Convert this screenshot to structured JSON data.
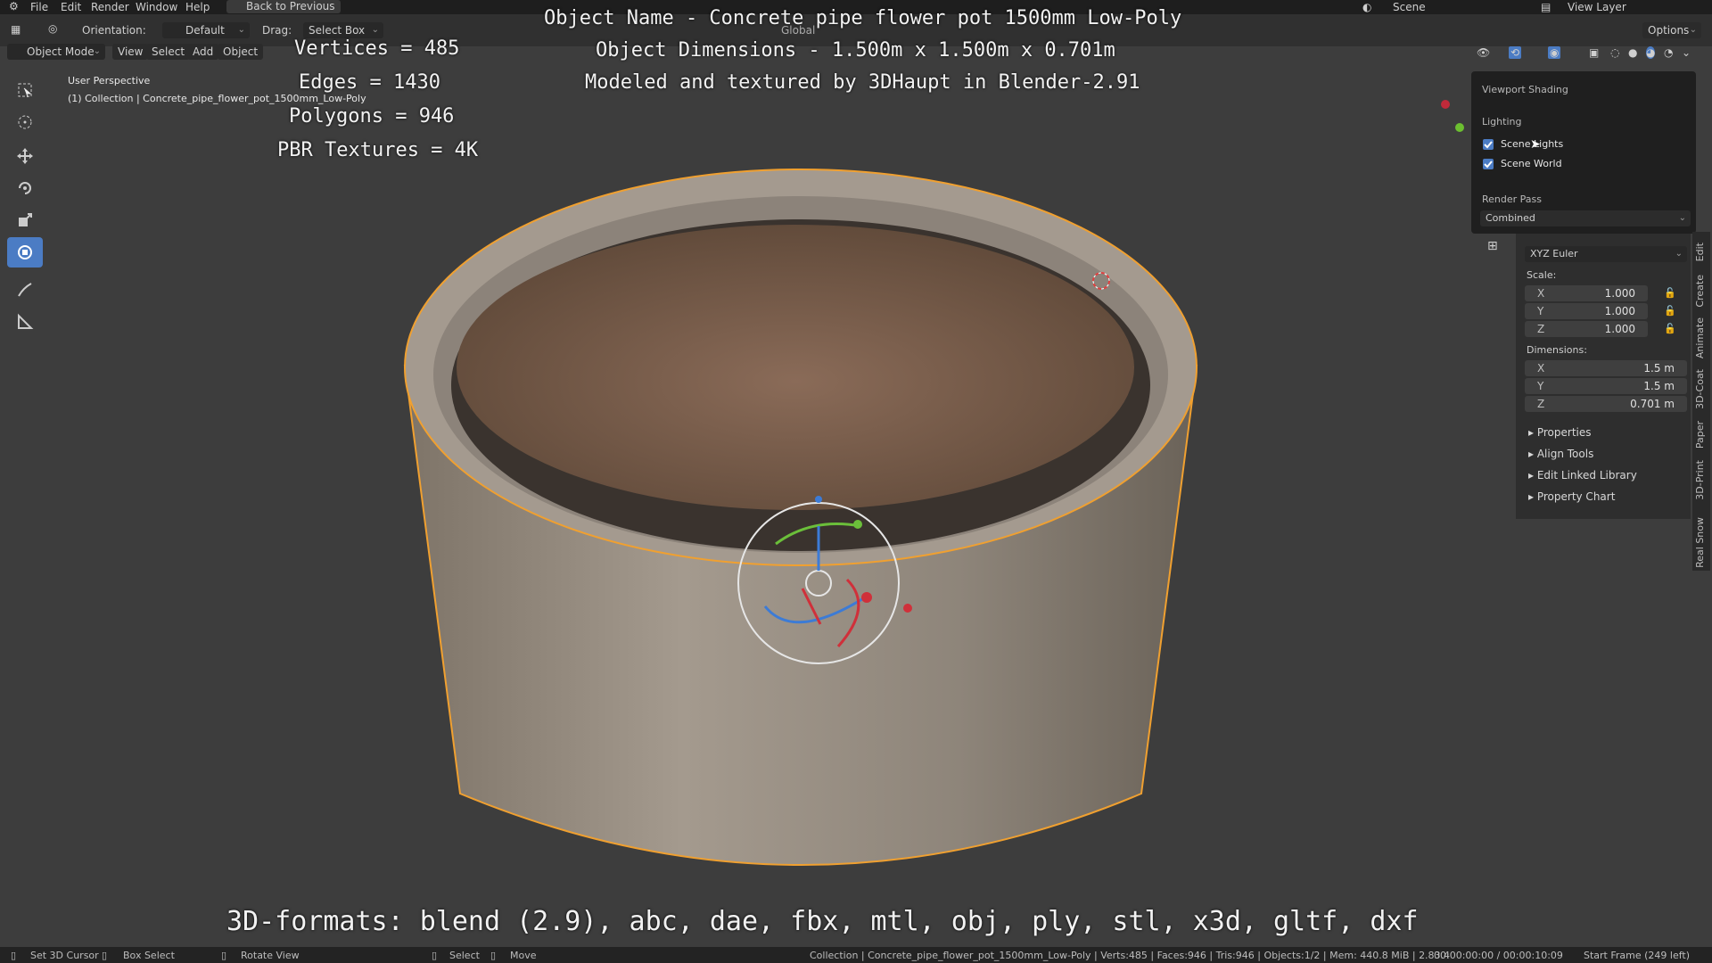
{
  "menu": {
    "items": [
      "File",
      "Edit",
      "Render",
      "Window",
      "Help"
    ],
    "back_button": "Back to Previous",
    "scene": "Scene",
    "view_layer": "View Layer"
  },
  "header": {
    "orientation_label": "Orientation:",
    "orientation_value": "Default",
    "drag_label": "Drag:",
    "drag_value": "Select Box",
    "transform_orientation": "Global",
    "options": "Options",
    "mode": "Object Mode",
    "menus": [
      "View",
      "Select",
      "Add",
      "Object"
    ]
  },
  "viewport": {
    "perspective": "User Perspective",
    "collection_info": "(1) Collection | Concrete_pipe_flower_pot_1500mm_Low-Poly",
    "stats": [
      "Vertices = 485",
      "Edges = 1430",
      "Polygons = 946",
      "PBR Textures = 4K"
    ],
    "title_lines": [
      "Object Name - Concrete pipe flower pot 1500mm Low-Poly",
      "Object Dimensions -  1.500m x 1.500m x 0.701m",
      "Modeled and textured by 3DHaupt in Blender-2.91"
    ],
    "formats": "3D-formats: blend (2.9), abc, dae, fbx, mtl, obj, ply, stl, x3d, gltf, dxf"
  },
  "shading_popover": {
    "title": "Viewport Shading",
    "lighting_label": "Lighting",
    "scene_lights": "Scene Lights",
    "scene_world": "Scene World",
    "render_pass_label": "Render Pass",
    "render_pass_value": "Combined"
  },
  "npanel": {
    "rotation_mode": "XYZ Euler",
    "scale_label": "Scale:",
    "scale": [
      {
        "axis": "X",
        "value": "1.000"
      },
      {
        "axis": "Y",
        "value": "1.000"
      },
      {
        "axis": "Z",
        "value": "1.000"
      }
    ],
    "dimensions_label": "Dimensions:",
    "dimensions": [
      {
        "axis": "X",
        "value": "1.5 m"
      },
      {
        "axis": "Y",
        "value": "1.5 m"
      },
      {
        "axis": "Z",
        "value": "0.701 m"
      }
    ],
    "sections": [
      "Properties",
      "Align Tools",
      "Edit Linked Library",
      "Property Chart"
    ],
    "tabs": [
      "Edit",
      "Create",
      "Animate",
      "3D-Coat",
      "Paper",
      "3D-Print",
      "Real Snow"
    ]
  },
  "status": {
    "cursor": "Set 3D Cursor",
    "box_select": "Box Select",
    "rotate": "Rotate View",
    "select": "Select",
    "move": "Move",
    "info": "Collection | Concrete_pipe_flower_pot_1500mm_Low-Poly | Verts:485 | Faces:946 | Tris:946 | Objects:1/2 | Mem: 440.8 MiB | 2.83.4",
    "time": "00:00:00:00 / 00:00:10:09",
    "frame": "Start Frame (249 left)"
  },
  "colors": {
    "accent": "#4b7cc4",
    "selection_outline": "#f0a030",
    "viewport_bg": "#3d3d3d"
  }
}
